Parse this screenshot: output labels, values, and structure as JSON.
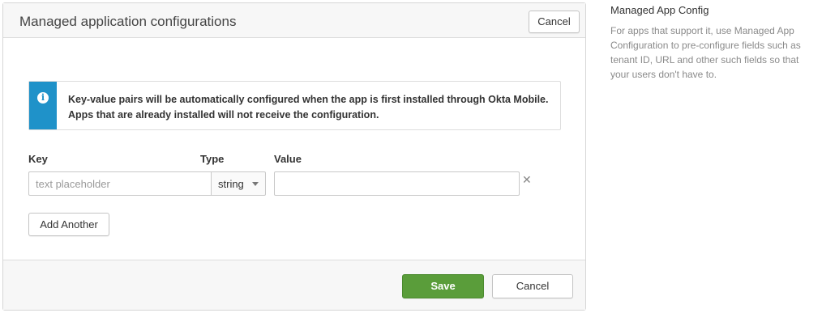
{
  "panel": {
    "title": "Managed application configurations",
    "header_cancel_label": "Cancel"
  },
  "callout": {
    "icon": "info-icon",
    "line1": "Key-value pairs will be automatically configured when the app is first installed through Okta Mobile.",
    "line2": "Apps that are already installed will not receive the configuration."
  },
  "form": {
    "key_label": "Key",
    "type_label": "Type",
    "value_label": "Value",
    "key_placeholder": "text placeholder",
    "key_value": "",
    "type_selected": "string",
    "value_value": "",
    "remove_icon": "close-icon",
    "add_another_label": "Add Another"
  },
  "footer": {
    "save_label": "Save",
    "cancel_label": "Cancel"
  },
  "sidebar": {
    "title": "Managed App Config",
    "description": "For apps that support it, use Managed App Configuration to pre-configure fields such as tenant ID, URL and other such fields so that your users don't have to."
  },
  "colors": {
    "accent_info": "#1f92c9",
    "save_button": "#5a9d3a"
  }
}
